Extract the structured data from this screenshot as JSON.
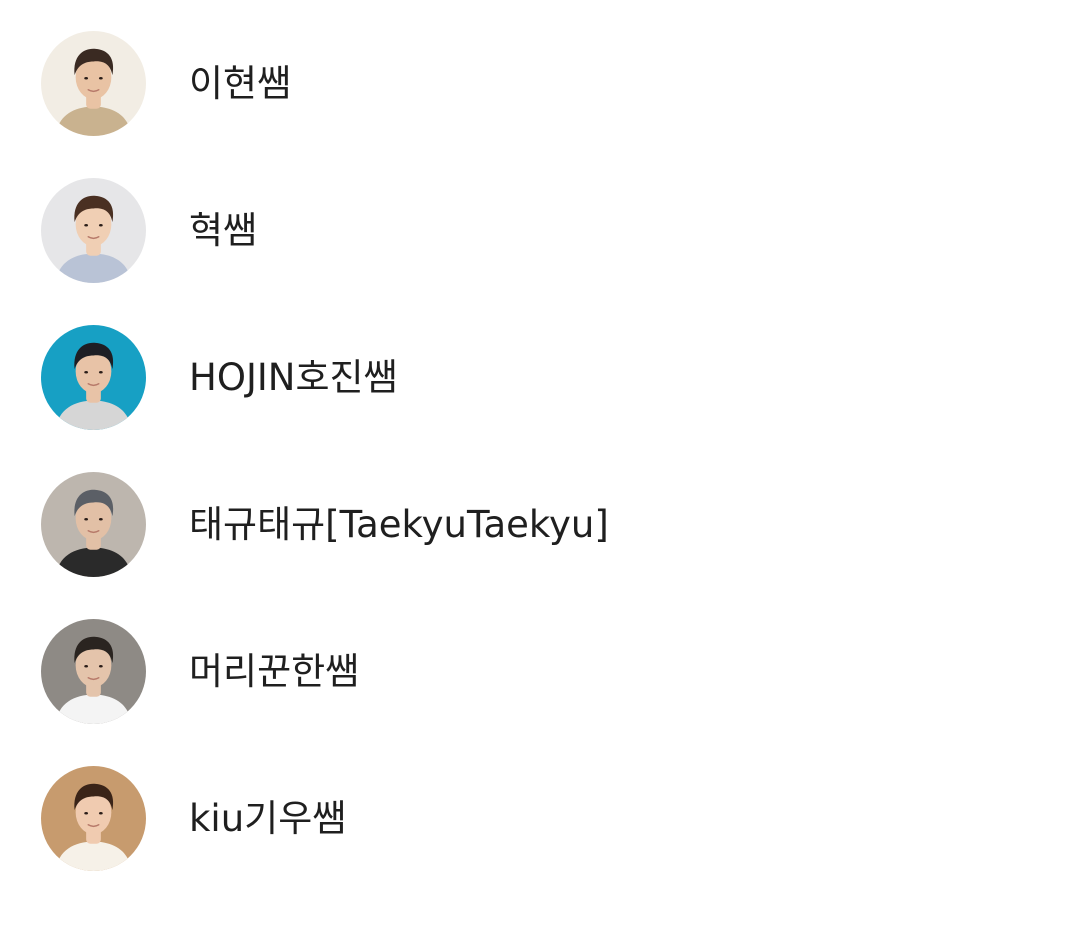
{
  "friends": [
    {
      "name": "이현쌤",
      "avatar": {
        "icon": "profile-photo",
        "bg": "#f2ede4",
        "skin": "#e9c3a4",
        "hair": "#3a2a22",
        "shirt": "#c9b28f"
      }
    },
    {
      "name": "혁쌤",
      "avatar": {
        "icon": "profile-photo",
        "bg": "#e6e6e8",
        "skin": "#f0cfb4",
        "hair": "#4a3022",
        "shirt": "#b9c3d6"
      }
    },
    {
      "name": "HOJIN호진쌤",
      "avatar": {
        "icon": "profile-photo",
        "bg": "#17a0c4",
        "skin": "#e8c3a7",
        "hair": "#1e1e24",
        "shirt": "#d6d6d6"
      }
    },
    {
      "name": "태규태규[TaekyuTaekyu]",
      "avatar": {
        "icon": "profile-photo",
        "bg": "#bdb6ae",
        "skin": "#e2c0a6",
        "hair": "#5b5f66",
        "shirt": "#2a2a2a"
      }
    },
    {
      "name": "머리꾼한쌤",
      "avatar": {
        "icon": "profile-photo",
        "bg": "#8e8a85",
        "skin": "#e4c4ab",
        "hair": "#2a2420",
        "shirt": "#f4f4f4"
      }
    },
    {
      "name": "kiu기우쌤",
      "avatar": {
        "icon": "profile-photo",
        "bg": "#c79b6e",
        "skin": "#f0cbb0",
        "hair": "#3a2418",
        "shirt": "#f6f1e8"
      }
    }
  ]
}
